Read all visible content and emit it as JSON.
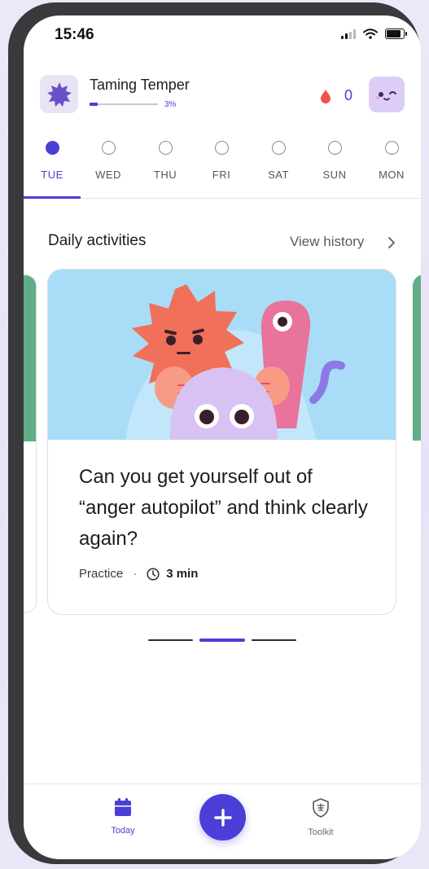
{
  "status_bar": {
    "time": "15:46"
  },
  "header": {
    "program_title": "Taming Temper",
    "progress_percent": 3,
    "progress_text": "3%",
    "streak_count": "0"
  },
  "days": [
    {
      "label": "TUE",
      "active": true
    },
    {
      "label": "WED",
      "active": false
    },
    {
      "label": "THU",
      "active": false
    },
    {
      "label": "FRI",
      "active": false
    },
    {
      "label": "SAT",
      "active": false
    },
    {
      "label": "SUN",
      "active": false
    },
    {
      "label": "MON",
      "active": false
    }
  ],
  "section": {
    "title": "Daily activities",
    "view_history_label": "View history"
  },
  "activity_card": {
    "heading": "Can you get yourself out of “anger autopilot” and think clearly again?",
    "category": "Practice",
    "separator": "·",
    "duration": "3 min"
  },
  "carousel": {
    "count": 3,
    "active_index": 1
  },
  "bottom_nav": {
    "today_label": "Today",
    "toolkit_label": "Toolkit"
  },
  "colors": {
    "accent": "#4b3fd7",
    "streak_drop": "#f0534a",
    "card_sky": "#a8dcf7",
    "side_card": "#5fae86",
    "sun_character": "#f0705a",
    "worm_character": "#e8739b",
    "blob_character": "#d8c2f3"
  },
  "icons": [
    "signal-icon",
    "wifi-icon",
    "battery-icon",
    "program-badge-icon",
    "drop-icon",
    "mascot-icon",
    "chevron-right-icon",
    "clock-icon",
    "calendar-icon",
    "plus-icon",
    "shield-icon"
  ]
}
